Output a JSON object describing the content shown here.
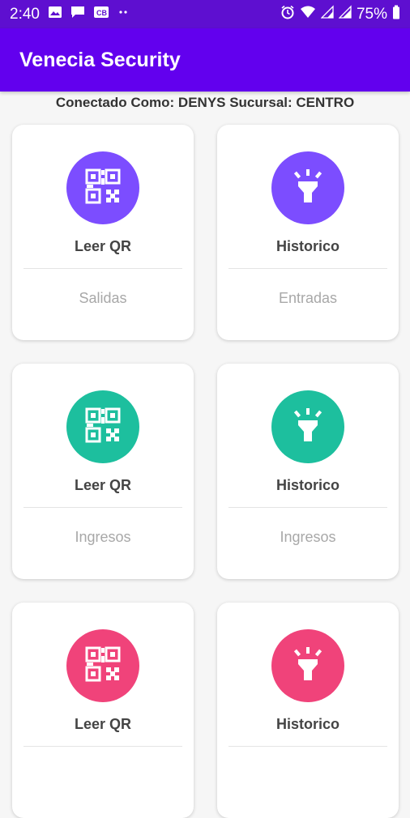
{
  "status_bar": {
    "time": "2:40",
    "battery": "75%",
    "icons_left": [
      "image-icon",
      "message-icon",
      "cast-icon",
      "more-dots-icon"
    ],
    "icons_right": [
      "alarm-icon",
      "wifi-icon",
      "signal-icon",
      "signal-icon",
      "battery-icon"
    ]
  },
  "app_bar": {
    "title": "Venecia Security"
  },
  "connection": {
    "text": "Conectado Como: DENYS Sucursal: CENTRO"
  },
  "colors": {
    "purple": "#7c4dff",
    "teal": "#1dbf9e",
    "pink": "#f0437a",
    "app_bar": "#6200ee"
  },
  "cards": [
    {
      "title": "Leer QR",
      "subtitle": "Salidas",
      "icon": "qr-code-icon",
      "color": "#7c4dff"
    },
    {
      "title": "Historico",
      "subtitle": "Entradas",
      "icon": "flashlight-icon",
      "color": "#7c4dff"
    },
    {
      "title": "Leer QR",
      "subtitle": "Ingresos",
      "icon": "qr-code-icon",
      "color": "#1dbf9e"
    },
    {
      "title": "Historico",
      "subtitle": "Ingresos",
      "icon": "flashlight-icon",
      "color": "#1dbf9e"
    },
    {
      "title": "Leer QR",
      "subtitle": "",
      "icon": "qr-code-icon",
      "color": "#f0437a"
    },
    {
      "title": "Historico",
      "subtitle": "",
      "icon": "flashlight-icon",
      "color": "#f0437a"
    }
  ]
}
